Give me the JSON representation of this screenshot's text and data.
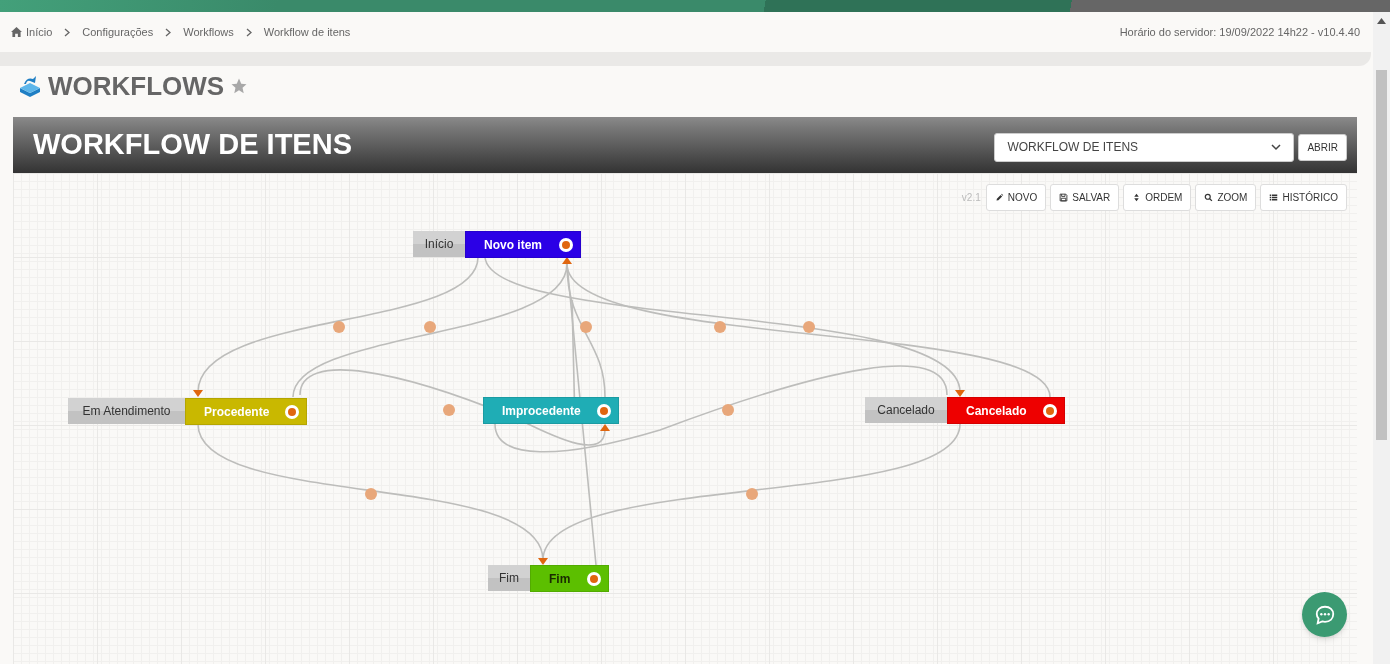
{
  "breadcrumb": [
    {
      "label": "Início"
    },
    {
      "label": "Configurações"
    },
    {
      "label": "Workflows"
    },
    {
      "label": "Workflow de itens"
    }
  ],
  "server_info": "Horário do servidor: 19/09/2022 14h22 - v10.4.40",
  "page_title": "WORKFLOWS",
  "favorite": false,
  "panel": {
    "title": "WORKFLOW DE ITENS",
    "select_value": "WORKFLOW DE ITENS",
    "open_button": "ABRIR"
  },
  "version": "v2.1",
  "toolbar": [
    {
      "kind": "pencil",
      "label": "NOVO"
    },
    {
      "kind": "save",
      "label": "SALVAR"
    },
    {
      "kind": "sort",
      "label": "ORDEM"
    },
    {
      "kind": "search",
      "label": "ZOOM"
    },
    {
      "kind": "list",
      "label": "HISTÓRICO"
    }
  ],
  "nodes": [
    {
      "stage": "Início",
      "status": "Novo item",
      "color": "#2b00e6",
      "dark_text": false
    },
    {
      "stage": "Em Atendimento",
      "status": "Procedente",
      "color": "#c9b800",
      "dark_text": false
    },
    {
      "status": "Improcedente",
      "color": "#1fadb5",
      "dark_text": false
    },
    {
      "stage": "Cancelado",
      "status": "Cancelado",
      "color": "#ee0000",
      "dark_text": false
    },
    {
      "stage": "Fim",
      "status": "Fim",
      "color": "#5cbf00",
      "dark_text": true
    }
  ]
}
